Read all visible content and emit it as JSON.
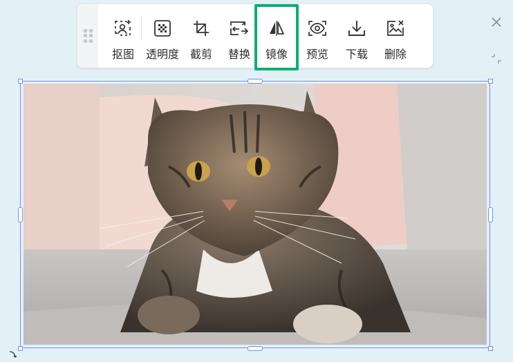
{
  "toolbar": {
    "tools": [
      {
        "label": "抠图",
        "icon": "cutout-icon"
      },
      {
        "label": "透明度",
        "icon": "transparency-icon"
      },
      {
        "label": "截剪",
        "icon": "crop-icon"
      },
      {
        "label": "替换",
        "icon": "replace-icon"
      },
      {
        "label": "镜像",
        "icon": "mirror-icon"
      },
      {
        "label": "预览",
        "icon": "preview-icon"
      },
      {
        "label": "下载",
        "icon": "download-icon"
      },
      {
        "label": "删除",
        "icon": "delete-image-icon"
      }
    ],
    "active_tool": "镜像",
    "highlight_color": "#08b070"
  },
  "canvas": {
    "image_subject": "tabby cat lying on a gray sofa with pink pillows",
    "selection_color": "#6f8ff0"
  }
}
